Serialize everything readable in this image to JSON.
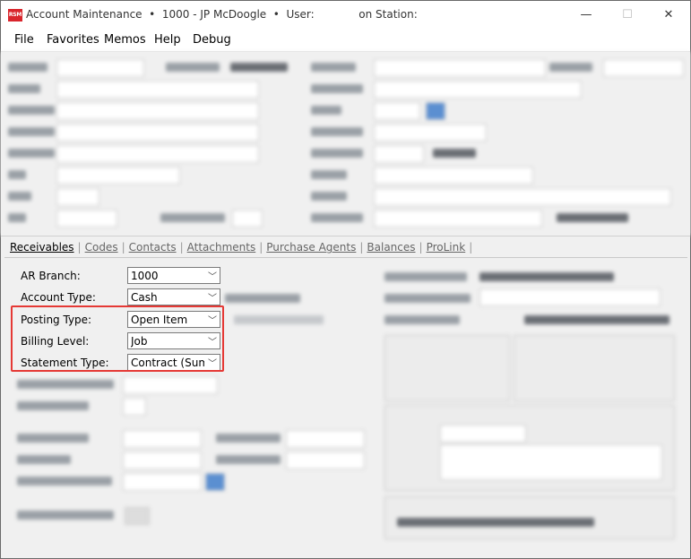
{
  "window": {
    "icon_text": "RSM",
    "title": "Account Maintenance  •  1000 - JP McDoogle  •  User:             on Station:",
    "controls": {
      "minimize": "—",
      "maximize": "☐",
      "close": "✕"
    }
  },
  "menu": [
    "File",
    "Favorites",
    "Memos",
    "Help",
    "Debug"
  ],
  "tabs": [
    "Receivables",
    "Codes",
    "Contacts",
    "Attachments",
    "Purchase Agents",
    "Balances",
    "ProLink"
  ],
  "receivables": {
    "ar_branch": {
      "label": "AR Branch:",
      "value": "1000"
    },
    "account_type": {
      "label": "Account Type:",
      "value": "Cash"
    },
    "posting_type": {
      "label": "Posting Type:",
      "value": "Open Item"
    },
    "billing_level": {
      "label": "Billing Level:",
      "value": "Job"
    },
    "statement_type": {
      "label": "Statement Type:",
      "value": "Contract (Summary)"
    }
  },
  "colors": {
    "highlight": "#e53935",
    "app_icon": "#d9252c"
  }
}
